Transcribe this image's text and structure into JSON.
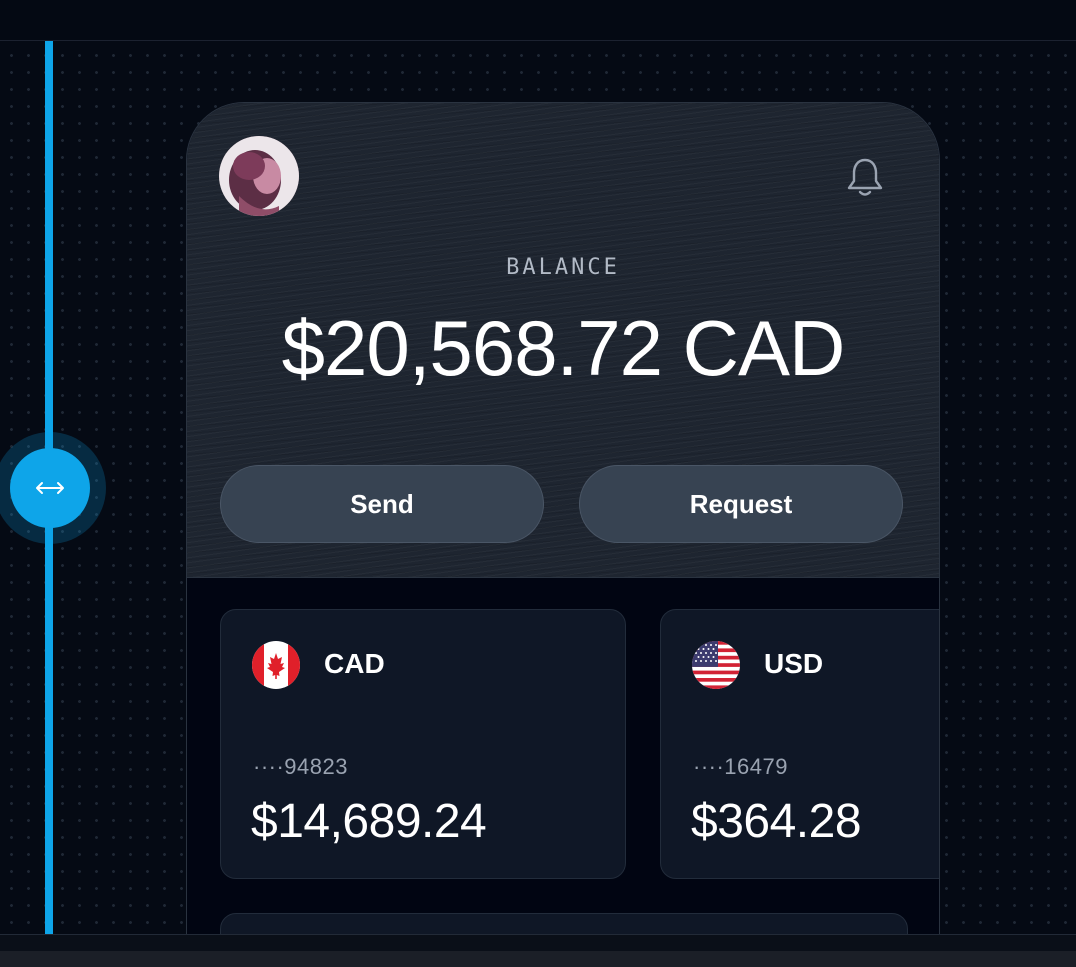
{
  "phone": {
    "balance_label": "BALANCE",
    "balance_amount": "$20,568.72 CAD",
    "send_label": "Send",
    "request_label": "Request"
  },
  "accounts": [
    {
      "currency": "CAD",
      "flag": "canada-flag-icon",
      "account_number": "····94823",
      "amount": "$14,689.24"
    },
    {
      "currency": "USD",
      "flag": "usa-flag-icon",
      "account_number": "····16479",
      "amount": "$364.28"
    }
  ],
  "colors": {
    "accent": "#0ea5e9",
    "background": "#050a14",
    "header_bg": "#1e2530",
    "button_bg": "#374352",
    "card_bg": "#0f1726"
  },
  "icons": {
    "resize": "resize-horizontal-icon",
    "notification": "bell-icon"
  }
}
